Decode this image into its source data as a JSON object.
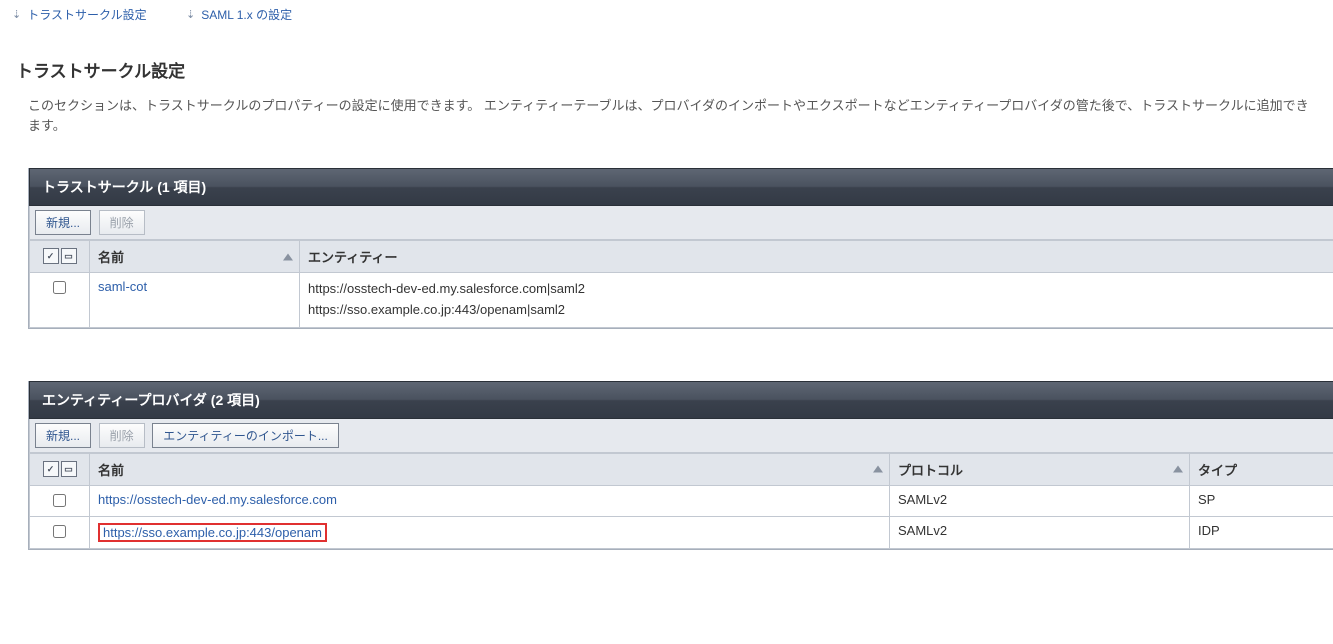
{
  "anchors": {
    "trustcircle": "トラストサークル設定",
    "saml": "SAML 1.x の設定"
  },
  "page": {
    "title": "トラストサークル設定",
    "description": "このセクションは、トラストサークルのプロパティーの設定に使用できます。 エンティティーテーブルは、プロバイダのインポートやエクスポートなどエンティティープロバイダの管た後で、トラストサークルに追加できます。"
  },
  "trustcircle": {
    "panel_title": "トラストサークル (1 項目)",
    "actions": {
      "new": "新規...",
      "delete": "削除"
    },
    "columns": {
      "name": "名前",
      "entity": "エンティティー"
    },
    "rows": [
      {
        "name": "saml-cot",
        "entities_line1": "https://osstech-dev-ed.my.salesforce.com|saml2",
        "entities_line2": "https://sso.example.co.jp:443/openam|saml2"
      }
    ]
  },
  "entityprovider": {
    "panel_title": "エンティティープロバイダ (2 項目)",
    "actions": {
      "new": "新規...",
      "delete": "削除",
      "import": "エンティティーのインポート..."
    },
    "columns": {
      "name": "名前",
      "protocol": "プロトコル",
      "type": "タイプ"
    },
    "rows": [
      {
        "name": "https://osstech-dev-ed.my.salesforce.com",
        "protocol": "SAMLv2",
        "type": "SP"
      },
      {
        "name": "https://sso.example.co.jp:443/openam",
        "protocol": "SAMLv2",
        "type": "IDP"
      }
    ]
  }
}
